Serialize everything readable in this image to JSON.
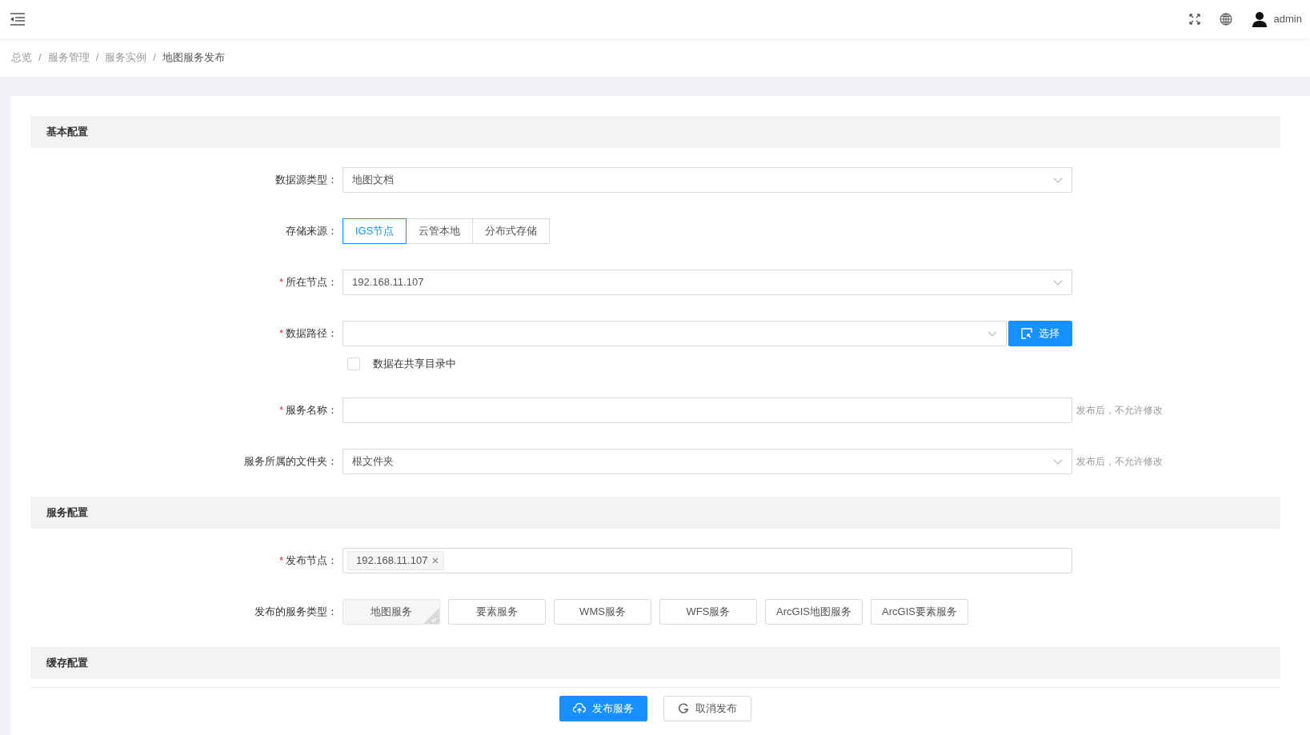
{
  "header": {
    "user": "admin"
  },
  "breadcrumb_separator": "/",
  "required_mark": "*",
  "breadcrumb": [
    {
      "label": "总览",
      "current": false
    },
    {
      "label": "服务管理",
      "current": false
    },
    {
      "label": "服务实例",
      "current": false
    },
    {
      "label": "地图服务发布",
      "current": true
    }
  ],
  "sections": [
    {
      "title": "基本配置",
      "fields": [
        {
          "kind": "select",
          "label": "数据源类型：",
          "required": false,
          "value": "地图文档"
        },
        {
          "kind": "segmented",
          "label": "存储来源：",
          "required": false,
          "options": [
            {
              "label": "IGS节点",
              "selected": true
            },
            {
              "label": "云管本地",
              "selected": false
            },
            {
              "label": "分布式存储",
              "selected": false
            }
          ]
        },
        {
          "kind": "select",
          "label": "所在节点：",
          "required": true,
          "value": "192.168.11.107"
        },
        {
          "kind": "path",
          "label": "数据路径：",
          "required": true,
          "button": "选择"
        },
        {
          "kind": "checkbox",
          "label": "数据在共享目录中",
          "checked": false
        },
        {
          "kind": "text",
          "label": "服务名称：",
          "required": true,
          "hint": "发布后，不允许修改"
        },
        {
          "kind": "select",
          "label": "服务所属的文件夹：",
          "required": false,
          "value": "根文件夹",
          "hint": "发布后，不允许修改"
        }
      ]
    },
    {
      "title": "服务配置",
      "fields": [
        {
          "kind": "tags",
          "label": "发布节点：",
          "required": true,
          "tags": [
            "192.168.11.107"
          ]
        },
        {
          "kind": "choices",
          "label": "发布的服务类型：",
          "required": false,
          "options": [
            {
              "label": "地图服务",
              "selected": true
            },
            {
              "label": "要素服务",
              "selected": false
            },
            {
              "label": "WMS服务",
              "selected": false
            },
            {
              "label": "WFS服务",
              "selected": false
            },
            {
              "label": "ArcGIS地图服务",
              "selected": false
            },
            {
              "label": "ArcGIS要素服务",
              "selected": false
            }
          ]
        }
      ]
    },
    {
      "title": "缓存配置"
    }
  ],
  "actions": [
    {
      "kind": "primary",
      "label": "发布服务"
    },
    {
      "kind": "secondary",
      "label": "取消发布"
    }
  ]
}
